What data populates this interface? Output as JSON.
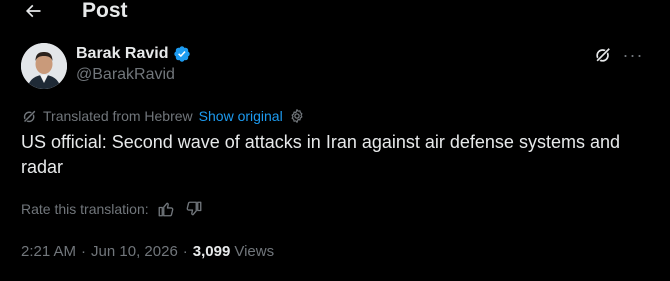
{
  "header": {
    "title": "Post",
    "back_icon": "arrow-left-icon"
  },
  "author": {
    "name": "Barak Ravid",
    "handle": "@BarakRavid",
    "verified_color": "#1d9bf0"
  },
  "actions": {
    "grok_icon": "grok-icon",
    "more_icon": "more-dots-icon",
    "more_label": "···"
  },
  "translation": {
    "label": "Translated from Hebrew",
    "show_original": "Show original",
    "rate_label": "Rate this translation:"
  },
  "post": {
    "text": "US official: Second wave of attacks in Iran against air defense systems and radar"
  },
  "meta": {
    "time": "2:21 AM",
    "separator": "·",
    "date": "Jun 10, 2026",
    "views_count": "3,099",
    "views_label": "Views"
  },
  "colors": {
    "background": "#000000",
    "text_primary": "#e7e9ea",
    "text_secondary": "#71767b",
    "accent": "#1d9bf0"
  }
}
